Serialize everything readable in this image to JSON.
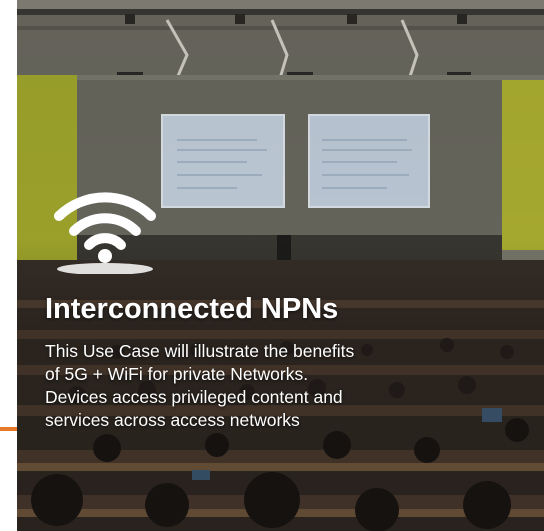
{
  "card": {
    "icon": "wifi-icon",
    "title": "Interconnected NPNs",
    "description_lines": [
      "This Use Case will illustrate the benefits",
      "of 5G + WiFi for private Networks.",
      "Devices access privileged content and",
      "services across access networks"
    ]
  },
  "colors": {
    "accent": "#e8792b",
    "text": "#ffffff"
  }
}
